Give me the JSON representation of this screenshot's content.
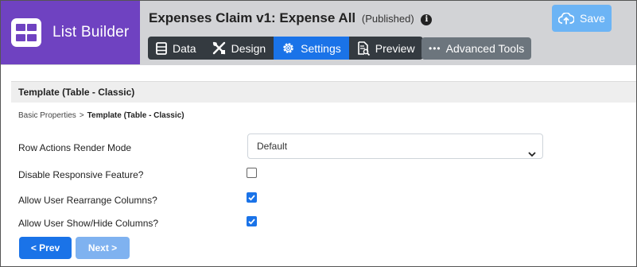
{
  "brand": {
    "title": "List Builder"
  },
  "header": {
    "title": "Expenses Claim v1: Expense All",
    "status": "(Published)",
    "info_glyph": "i"
  },
  "tabs": [
    {
      "label": "Data",
      "icon": "table-icon",
      "active": false
    },
    {
      "label": "Design",
      "icon": "tools-icon",
      "active": false
    },
    {
      "label": "Settings",
      "icon": "gear-icon",
      "active": true
    },
    {
      "label": "Preview",
      "icon": "document-search-icon",
      "active": false
    }
  ],
  "advanced_tools": {
    "label": "Advanced Tools",
    "glyph": "•••"
  },
  "save_button": {
    "label": "Save"
  },
  "section": {
    "title": "Template (Table - Classic)"
  },
  "breadcrumb": {
    "parent": "Basic Properties",
    "separator": ">",
    "current": "Template (Table - Classic)"
  },
  "fields": {
    "row_actions_render_mode": {
      "label": "Row Actions Render Mode",
      "value": "Default"
    },
    "disable_responsive": {
      "label": "Disable Responsive Feature?",
      "checked": false
    },
    "allow_rearrange": {
      "label": "Allow User Rearrange Columns?",
      "checked": true
    },
    "allow_show_hide": {
      "label": "Allow User Show/Hide Columns?",
      "checked": true
    }
  },
  "nav": {
    "prev_label": "< Prev",
    "next_label": "Next >"
  },
  "colors": {
    "brand": "#6f42c1",
    "accent": "#1a73e8",
    "tab_bar": "#343a40",
    "save_button": "#6cb4f5",
    "next_disabled": "#7fb2f0"
  }
}
